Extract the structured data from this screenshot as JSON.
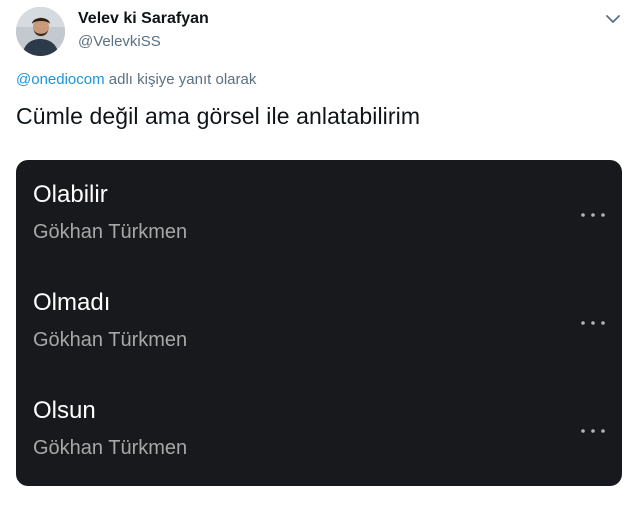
{
  "author": {
    "display_name": "Velev ki Sarafyan",
    "handle": "@VelevkiSS"
  },
  "reply_context": {
    "mention": "@onediocom",
    "suffix": " adlı kişiye yanıt olarak"
  },
  "tweet": {
    "text": "Cümle değil ama görsel ile anlatabilirim"
  },
  "media": {
    "background_color": "#18191d",
    "tracks": [
      {
        "title": "Olabilir",
        "artist": "Gökhan Türkmen"
      },
      {
        "title": "Olmadı",
        "artist": "Gökhan Türkmen"
      },
      {
        "title": "Olsun",
        "artist": "Gökhan Türkmen"
      }
    ]
  },
  "icons": {
    "tweet_menu": "chevron-down-icon",
    "track_menu": "more-horizontal-icon"
  },
  "colors": {
    "link": "#1b95e0",
    "secondary_text": "#5b7083",
    "artist_text": "#a7a7a7"
  }
}
